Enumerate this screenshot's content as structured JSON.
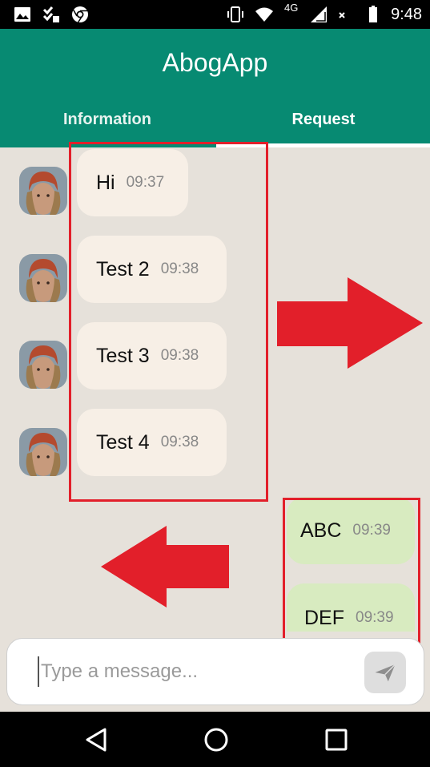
{
  "status_bar": {
    "time": "9:48",
    "network": "4G",
    "icons": [
      "image-icon",
      "checklist-icon",
      "chrome-icon",
      "vibrate-icon",
      "wifi-icon",
      "signal-icon",
      "battery-icon"
    ]
  },
  "app": {
    "title": "AbogApp",
    "tabs": [
      {
        "label": "Information",
        "selected": false
      },
      {
        "label": "Request",
        "selected": true
      }
    ],
    "accent_color": "#078a72"
  },
  "messages": {
    "incoming": [
      {
        "text": "Hi",
        "time": "09:37"
      },
      {
        "text": "Test 2",
        "time": "09:38"
      },
      {
        "text": "Test 3",
        "time": "09:38"
      },
      {
        "text": "Test 4",
        "time": "09:38"
      }
    ],
    "outgoing": [
      {
        "text": "ABC",
        "time": "09:39"
      },
      {
        "text": "DEF",
        "time": "09:39"
      }
    ]
  },
  "composer": {
    "placeholder": "Type a message...",
    "value": ""
  },
  "annotations": {
    "highlight_color": "#e21f2a"
  },
  "nav_bar": {
    "icons": [
      "back-icon",
      "home-icon",
      "recents-icon"
    ]
  }
}
